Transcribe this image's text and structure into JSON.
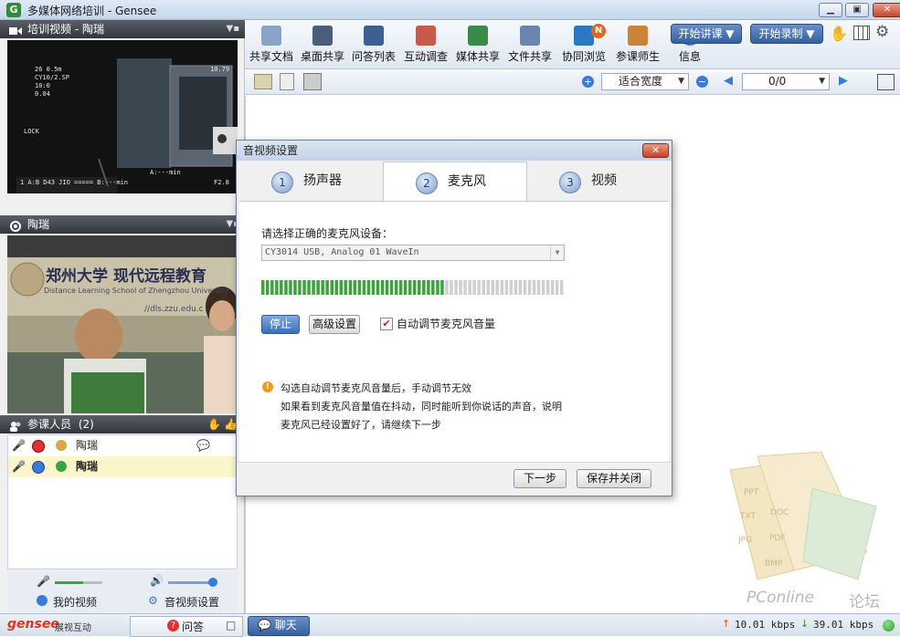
{
  "window": {
    "title": "多媒体网络培训 - Gensee",
    "minimize": "▁",
    "maximize": "▣",
    "close": "✕"
  },
  "left": {
    "video_panel_title": "培训视频 - 陶瑞",
    "video_overlay": {
      "line1": "26  0.5m",
      "line2": "CY10/2.SP",
      "line3": "10:0",
      "line4": "0.04",
      "line5": "LOCK",
      "rt": "10.79",
      "bottom": "1  A:B  D43  JIO  =====  B:---min",
      "bottom_mid": "A:---min",
      "bottom_right": "F2.8"
    },
    "camera_panel_title": "陶瑞",
    "banner_text": "郑州大学 现代远程教育",
    "banner_sub": "Distance Learning School of Zhengzhou University",
    "banner_url": "//dls.zzu.edu.c",
    "participants_title": "参课人员",
    "participants_count": "(2)",
    "participants": [
      {
        "name": "陶瑞",
        "bold": false
      },
      {
        "name": "陶瑞",
        "bold": true
      }
    ],
    "my_video_label": "我的视频",
    "av_settings_label": "音视频设置",
    "mic_level": 0.6,
    "speaker_level": 0.95,
    "brand": "gensee",
    "brand_sub": "展视互动",
    "qa_label": "问答",
    "qa_close": "□"
  },
  "toolbar": {
    "tools": [
      {
        "label": "共享文档",
        "color": "#8aa3c8"
      },
      {
        "label": "桌面共享",
        "color": "#4a5d7a"
      },
      {
        "label": "问答列表",
        "color": "#3e5f91"
      },
      {
        "label": "互动调查",
        "color": "#c95a4a"
      },
      {
        "label": "媒体共享",
        "color": "#3a8a4a"
      },
      {
        "label": "文件共享",
        "color": "#6a86b0"
      },
      {
        "label": "协同浏览",
        "color": "#2a78c0"
      },
      {
        "label": "参课师生",
        "color": "#c9843a"
      },
      {
        "label": "信息",
        "color": "#4a78b8"
      }
    ],
    "badge": "N",
    "start_lecture": "开始讲课 ▼",
    "start_record": "开始录制 ▼"
  },
  "subtoolbar": {
    "fit_option": "适合宽度",
    "page_indicator": "0/0"
  },
  "dialog": {
    "title": "音视频设置",
    "close": "✕",
    "tabs": [
      {
        "num": "1",
        "label": "扬声器"
      },
      {
        "num": "2",
        "label": "麦克风"
      },
      {
        "num": "3",
        "label": "视频"
      }
    ],
    "active_tab": 1,
    "device_prompt": "请选择正确的麦克风设备：",
    "device_value": "CY3014 USB, Analog 01 WaveIn",
    "volume_level": 0.6,
    "stop_button": "停止",
    "advanced_button": "高级设置",
    "auto_adjust_label": "自动调节麦克风音量",
    "auto_adjust_checked": true,
    "notice_line1": "勾选自动调节麦克风音量后，手动调节无效",
    "notice_line2": "如果看到麦克风音量值在抖动，同时能听到你说话的声音，说明",
    "notice_line3": "麦克风已经设置好了，请继续下一步",
    "next_button": "下一步",
    "save_close_button": "保存并关闭"
  },
  "status": {
    "chat_label": "聊天",
    "upload_speed": "10.01 kbps",
    "download_speed": "39.01 kbps"
  },
  "watermark": {
    "doc_labels": [
      "PPT",
      "DOC",
      "TXT",
      "PDF",
      "JPG",
      "BMP"
    ],
    "site": "PConline",
    "forum": "论坛"
  }
}
